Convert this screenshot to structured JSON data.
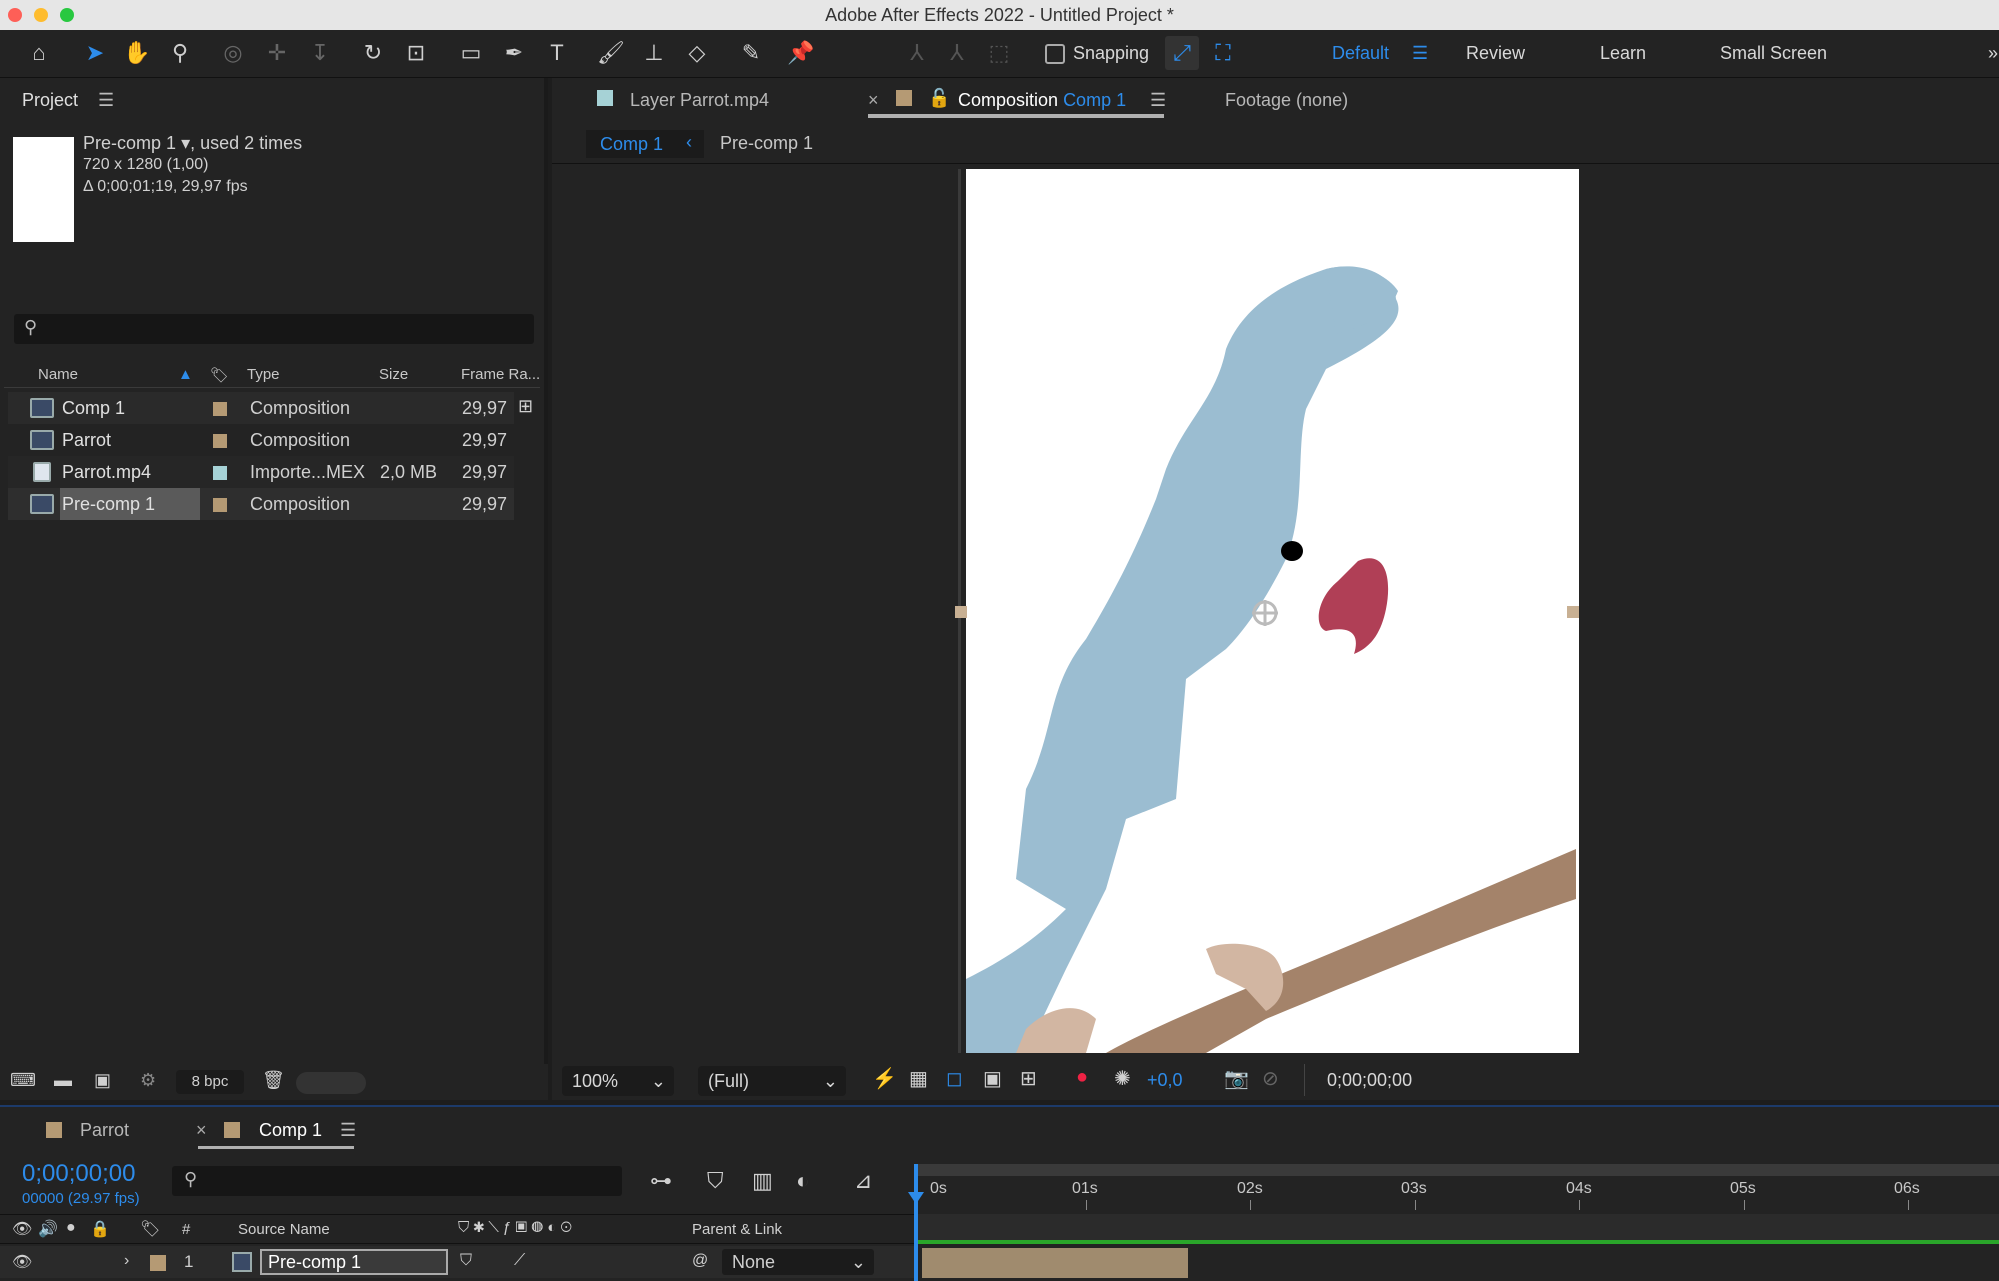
{
  "window": {
    "title": "Adobe After Effects 2022 - Untitled Project *"
  },
  "toolbar": {
    "snapping_label": "Snapping",
    "workspaces": [
      "Default",
      "Review",
      "Learn",
      "Small Screen"
    ]
  },
  "project": {
    "panel_title": "Project",
    "selected_item": {
      "name": "Pre-comp 1",
      "usage": ", used 2 times",
      "dimensions": "720 x 1280 (1,00)",
      "duration": "Δ 0;00;01;19, 29,97 fps"
    },
    "columns": [
      "Name",
      "Type",
      "Size",
      "Frame Ra..."
    ],
    "items": [
      {
        "name": "Comp 1",
        "type": "Composition",
        "size": "",
        "frame_rate": "29,97",
        "swatch": "#b59a74"
      },
      {
        "name": "Parrot",
        "type": "Composition",
        "size": "",
        "frame_rate": "29,97",
        "swatch": "#b59a74"
      },
      {
        "name": "Parrot.mp4",
        "type": "Importe...MEX",
        "size": "2,0 MB",
        "frame_rate": "29,97",
        "swatch": "#a6d2d6"
      },
      {
        "name": "Pre-comp 1",
        "type": "Composition",
        "size": "",
        "frame_rate": "29,97",
        "swatch": "#b59a74"
      }
    ],
    "bpc": "8 bpc"
  },
  "viewer": {
    "tabs": {
      "layer": "Layer Parrot.mp4",
      "composition_prefix": "Composition",
      "composition_name": "Comp 1",
      "footage": "Footage (none)"
    },
    "breadcrumb": {
      "current": "Comp 1",
      "child": "Pre-comp 1"
    },
    "zoom": "100%",
    "resolution": "(Full)",
    "exposure": "+0,0",
    "timecode": "0;00;00;00"
  },
  "timeline": {
    "tabs": [
      "Parrot",
      "Comp 1"
    ],
    "current_time": "0;00;00;00",
    "frame_info": "00000 (29.97 fps)",
    "ruler": [
      "0s",
      "01s",
      "02s",
      "03s",
      "04s",
      "05s",
      "06s"
    ],
    "columns": {
      "number": "#",
      "source_name": "Source Name",
      "parent": "Parent & Link"
    },
    "layer": {
      "number": "1",
      "name": "Pre-comp 1",
      "parent": "None"
    }
  }
}
